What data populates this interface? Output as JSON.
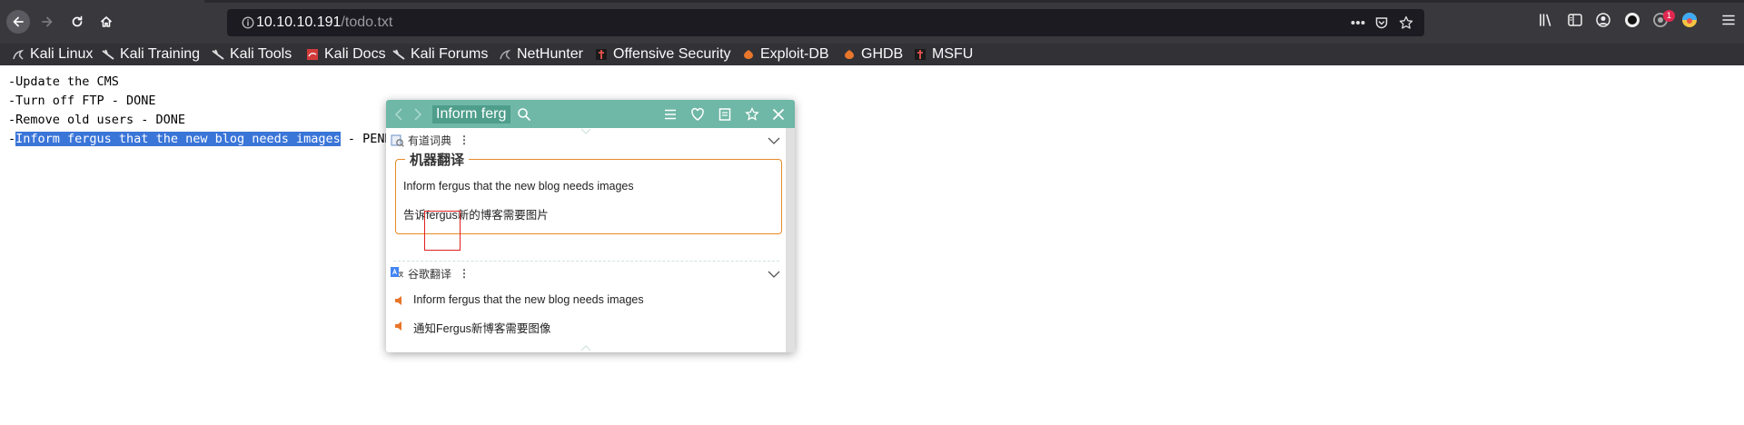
{
  "browser": {
    "url_host": "10.10.10.191",
    "url_path": "/todo.txt",
    "notification_badge": "1"
  },
  "bookmarks": [
    {
      "label": "Kali Linux",
      "icon": "kali-dragon-icon"
    },
    {
      "label": "Kali Training",
      "icon": "kali-training-icon"
    },
    {
      "label": "Kali Tools",
      "icon": "kali-tools-icon"
    },
    {
      "label": "Kali Docs",
      "icon": "kali-docs-icon"
    },
    {
      "label": "Kali Forums",
      "icon": "kali-forums-icon"
    },
    {
      "label": "NetHunter",
      "icon": "nethunter-icon"
    },
    {
      "label": "Offensive Security",
      "icon": "offsec-icon"
    },
    {
      "label": "Exploit-DB",
      "icon": "exploit-db-icon"
    },
    {
      "label": "GHDB",
      "icon": "ghdb-icon"
    },
    {
      "label": "MSFU",
      "icon": "msfu-icon"
    }
  ],
  "page": {
    "lines": [
      "-Update the CMS",
      "-Turn off FTP - DONE",
      "-Remove old users - DONE"
    ],
    "line4_prefix": "-",
    "line4_selected": "Inform fergus that the new blog needs images",
    "line4_suffix": " - PEND"
  },
  "popup": {
    "search_text": "Inform ferg",
    "youdao": {
      "title": "有道词典",
      "section_title": "机器翻译",
      "source": "Inform fergus that the new blog needs images",
      "translation": "告诉fergus新的博客需要图片"
    },
    "google": {
      "title": "谷歌翻译",
      "source": "Inform fergus that the new blog needs images",
      "translation": "通知Fergus新博客需要图像"
    }
  },
  "colors": {
    "toolbar": "#38383d",
    "popup_header": "#6fb7a6",
    "selection": "#3a75d8",
    "fieldset_border": "#e68a28"
  }
}
